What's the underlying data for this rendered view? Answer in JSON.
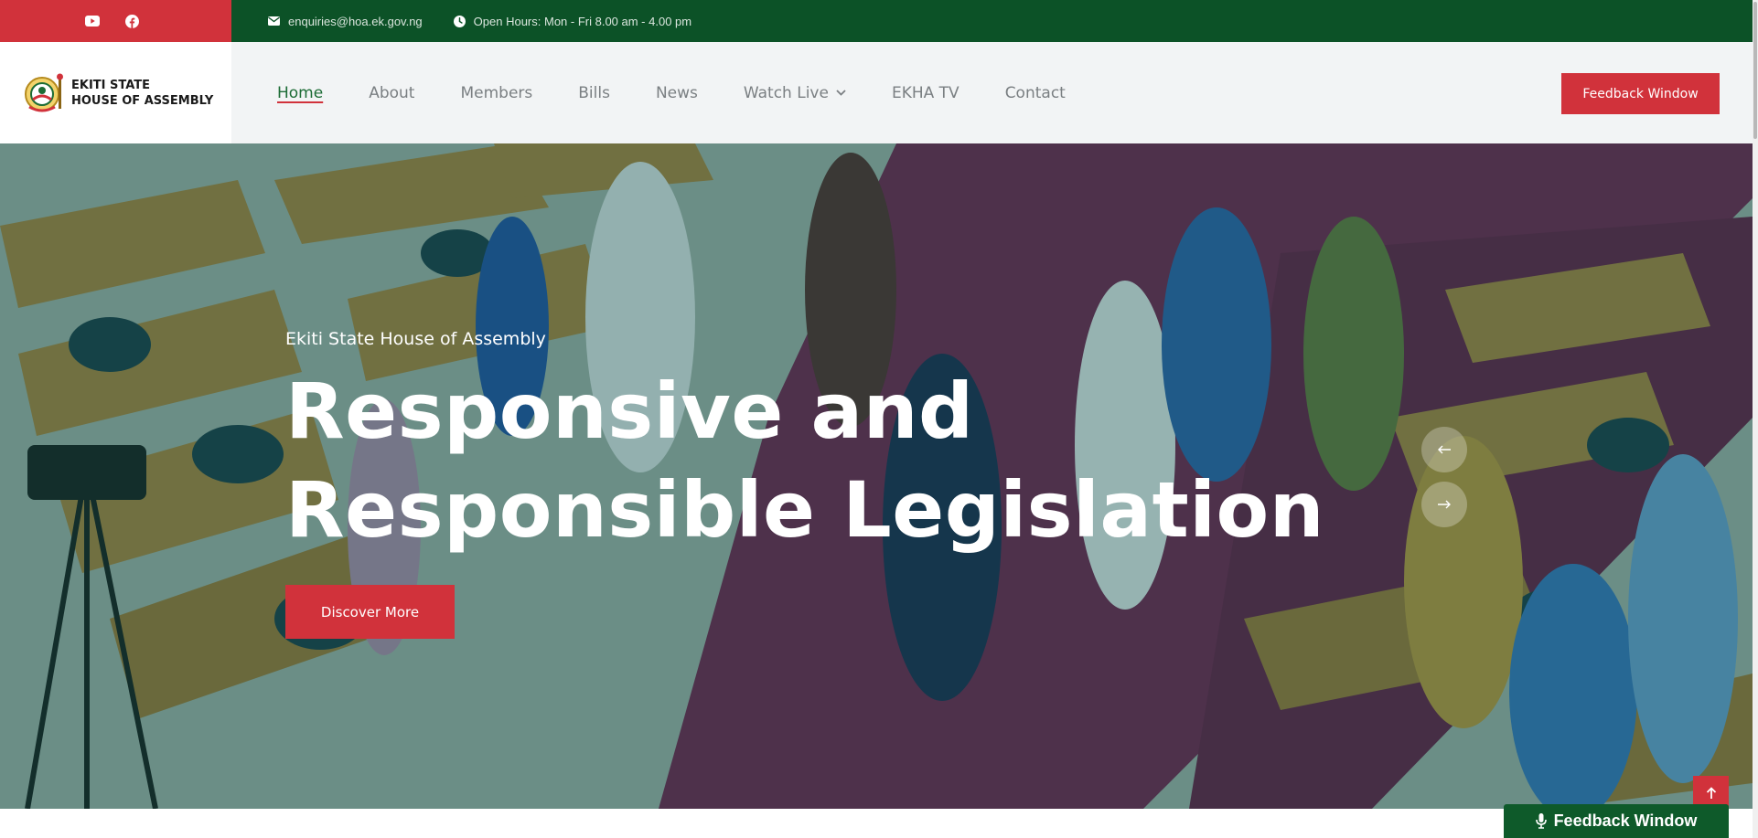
{
  "topbar": {
    "social": [
      {
        "icon": "youtube-icon"
      },
      {
        "icon": "facebook-icon"
      }
    ],
    "email": "enquiries@hoa.ek.gov.ng",
    "hours": "Open Hours: Mon - Fri 8.00 am - 4.00 pm"
  },
  "logo": {
    "line1": "EKITI STATE",
    "line2": "HOUSE OF ASSEMBLY"
  },
  "nav": {
    "items": [
      {
        "label": "Home",
        "active": true
      },
      {
        "label": "About"
      },
      {
        "label": "Members"
      },
      {
        "label": "Bills"
      },
      {
        "label": "News"
      },
      {
        "label": "Watch Live",
        "has_dropdown": true
      },
      {
        "label": "EKHA TV"
      },
      {
        "label": "Contact"
      }
    ],
    "cta_label": "Feedback Window"
  },
  "hero": {
    "kicker": "Ekiti State House of Assembly",
    "title_line1": "Responsive and",
    "title_line2": "Responsible Legislation",
    "button_label": "Discover More"
  },
  "floating": {
    "feedback_label": "Feedback Window"
  },
  "colors": {
    "brand_red": "#d1323b",
    "brand_green": "#0c5227",
    "carpet": "#7a1f4e"
  }
}
